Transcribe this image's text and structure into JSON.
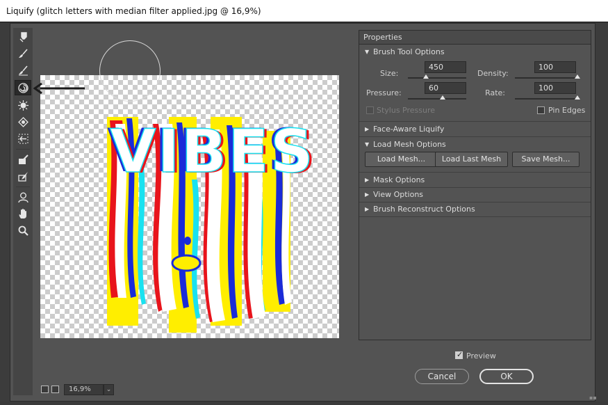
{
  "window": {
    "title": "Liquify (glitch letters with median filter applied.jpg @ 16,9%)"
  },
  "toolbar": {
    "tools": [
      {
        "name": "forward-warp-tool",
        "icon": "finger-smudge-icon",
        "active": false
      },
      {
        "name": "reconstruct-tool",
        "icon": "brush-icon",
        "active": false
      },
      {
        "name": "smooth-tool",
        "icon": "brush-smooth-icon",
        "active": false
      },
      {
        "name": "twirl-clockwise-tool",
        "icon": "twirl-icon",
        "active": true
      },
      {
        "name": "pucker-tool",
        "icon": "pucker-icon",
        "active": false
      },
      {
        "name": "bloat-tool",
        "icon": "bloat-icon",
        "active": false
      },
      {
        "name": "push-left-tool",
        "icon": "push-left-icon",
        "active": false
      },
      {
        "name": "freeze-mask-tool",
        "icon": "freeze-mask-icon",
        "active": false
      },
      {
        "name": "thaw-mask-tool",
        "icon": "thaw-mask-icon",
        "active": false
      },
      {
        "name": "face-tool",
        "icon": "face-icon",
        "active": false
      },
      {
        "name": "hand-tool",
        "icon": "hand-icon",
        "active": false
      },
      {
        "name": "zoom-tool",
        "icon": "zoom-icon",
        "active": false
      }
    ]
  },
  "canvas": {
    "artwork_text": "VIBES"
  },
  "statusbar": {
    "zoom": "16,9%"
  },
  "properties": {
    "header": "Properties",
    "brush_tool_options": {
      "label": "Brush Tool Options",
      "size_label": "Size:",
      "size_value": "450",
      "size_level_pct": 31,
      "density_label": "Density:",
      "density_value": "100",
      "density_level_pct": 100,
      "pressure_label": "Pressure:",
      "pressure_value": "60",
      "pressure_level_pct": 60,
      "rate_label": "Rate:",
      "rate_value": "100",
      "rate_level_pct": 100,
      "stylus_pressure_label": "Stylus Pressure",
      "stylus_pressure_checked": false,
      "pin_edges_label": "Pin Edges",
      "pin_edges_checked": false
    },
    "face_aware_liquify": {
      "label": "Face-Aware Liquify"
    },
    "load_mesh_options": {
      "label": "Load Mesh Options",
      "load_mesh_button": "Load Mesh...",
      "load_last_mesh_button": "Load Last Mesh",
      "save_mesh_button": "Save Mesh..."
    },
    "mask_options": {
      "label": "Mask Options"
    },
    "view_options": {
      "label": "View Options"
    },
    "brush_reconstruct_options": {
      "label": "Brush Reconstruct Options"
    }
  },
  "footer": {
    "preview_label": "Preview",
    "preview_checked": true,
    "cancel_label": "Cancel",
    "ok_label": "OK"
  },
  "colors": {
    "panel_bg": "#535353",
    "artwork_red": "#e8141b",
    "artwork_blue": "#1a2bd8",
    "artwork_cyan": "#19e2f0",
    "artwork_yellow": "#ffee00"
  }
}
